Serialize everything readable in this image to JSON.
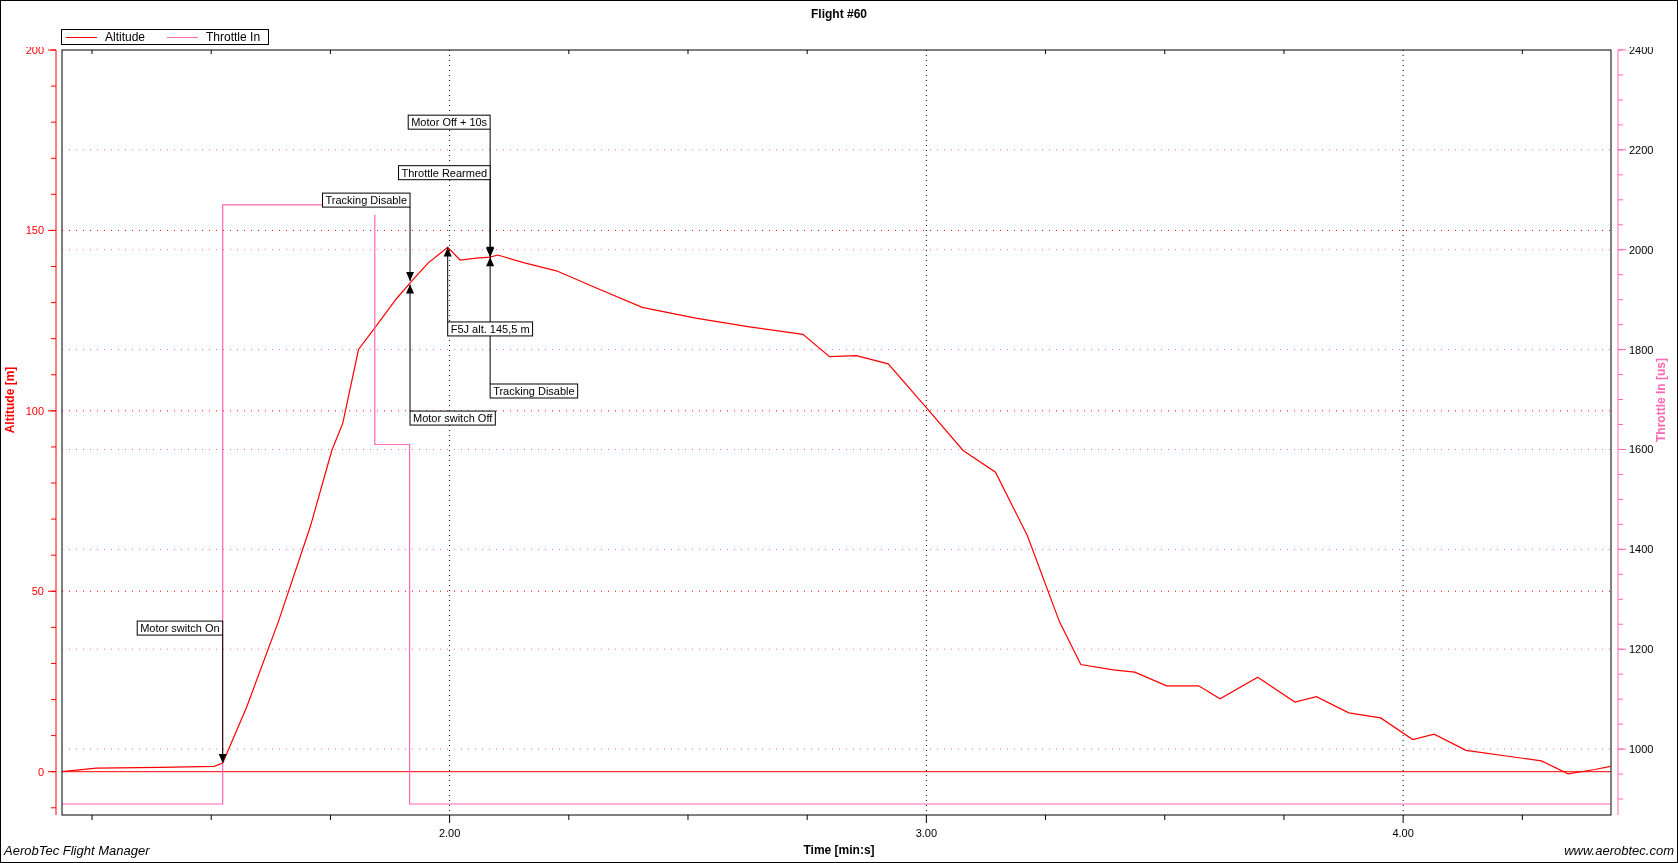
{
  "chart_data": {
    "type": "line",
    "title": "Flight #60",
    "xlabel": "Time [min:s]",
    "ylabel": "Altitude [m]",
    "y2label": "Throttle In [us]",
    "grid": true,
    "ref_lines": [
      {
        "axis": "y",
        "value": 0,
        "color": "#ff0000"
      }
    ],
    "xlim": [
      1.187,
      4.436
    ],
    "ylim": [
      -12,
      200
    ],
    "y2lim": [
      868,
      2400
    ],
    "xticks": [
      {
        "value": 2,
        "label": "2.00"
      },
      {
        "value": 3,
        "label": "3.00"
      },
      {
        "value": 4,
        "label": "4.00"
      }
    ],
    "yticks": [
      0,
      50,
      100,
      150,
      200
    ],
    "y2ticks": [
      1000,
      1200,
      1400,
      1600,
      1800,
      2000,
      2200,
      2400
    ],
    "series": [
      {
        "name": "Altitude",
        "color": "#ff0000",
        "x": [
          1.187,
          1.259,
          1.394,
          1.506,
          1.524,
          1.574,
          1.641,
          1.708,
          1.753,
          1.776,
          1.809,
          1.843,
          1.888,
          1.921,
          1.955,
          1.996,
          2.022,
          2.056,
          2.085,
          2.101,
          2.157,
          2.224,
          2.314,
          2.404,
          2.516,
          2.629,
          2.741,
          2.797,
          2.853,
          2.92,
          2.999,
          3.077,
          3.145,
          3.212,
          3.279,
          3.324,
          3.392,
          3.437,
          3.504,
          3.571,
          3.616,
          3.695,
          3.773,
          3.818,
          3.886,
          3.953,
          4.02,
          4.065,
          4.132,
          4.29,
          4.346,
          4.402,
          4.435
        ],
        "values": [
          0,
          1,
          1.2,
          1.5,
          2.4,
          17.8,
          41.6,
          68,
          89,
          96.6,
          117,
          123,
          131,
          136,
          141,
          145.3,
          141.8,
          142.3,
          142.6,
          143.2,
          141,
          138.8,
          133.7,
          128.7,
          125.7,
          123.3,
          121.2,
          115,
          115.3,
          113,
          101,
          89,
          83,
          65.4,
          41.6,
          29.7,
          28.2,
          27.6,
          23.8,
          23.8,
          20.2,
          26.2,
          19.3,
          20.8,
          16.3,
          14.9,
          8.9,
          10.4,
          5.9,
          3,
          -0.6,
          0.6,
          1.5
        ]
      },
      {
        "name": "Throttle In",
        "color": "#ff66b3",
        "axis": "y2",
        "x": [
          1.187,
          1.524,
          1.524,
          1.733,
          null,
          1.843,
          1.843,
          1.916,
          1.916,
          4.435
        ],
        "values": [
          890,
          890,
          2090,
          2090,
          null,
          2070,
          1610,
          1610,
          890,
          890
        ]
      }
    ],
    "annotations": [
      {
        "text": "Motor switch On",
        "x": 1.524,
        "y": 2.4
      },
      {
        "text": "Tracking Disable",
        "x": 1.917,
        "y": 136
      },
      {
        "text": "Motor switch Off",
        "x": 1.917,
        "y": 135
      },
      {
        "text": "Throttle Rearmed",
        "x": 2.085,
        "y": 142.6
      },
      {
        "text": "Motor Off + 10s",
        "x": 2.085,
        "y": 143
      },
      {
        "text": "F5J alt. 145,5 m",
        "x": 1.996,
        "y": 145.3
      },
      {
        "text": "Tracking Disable",
        "x": 2.085,
        "y": 142.6
      }
    ]
  },
  "footer": {
    "app_name": "AerobTec Flight Manager",
    "website": "www.aerobtec.com"
  }
}
